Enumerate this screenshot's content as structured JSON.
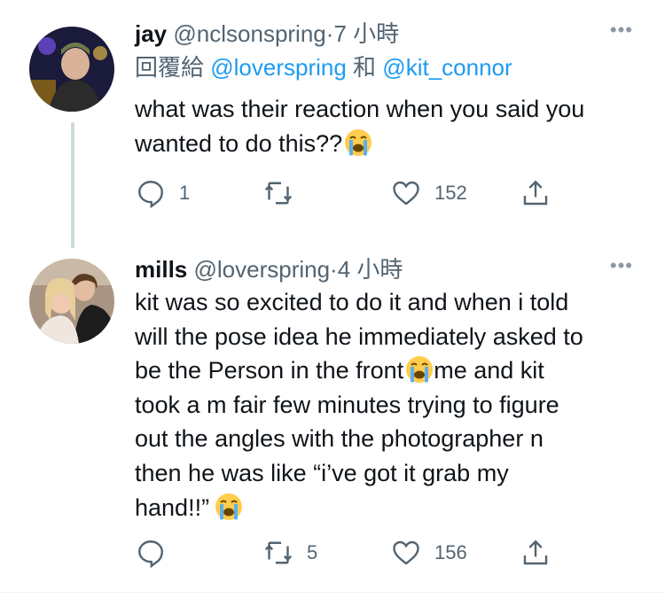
{
  "tweets": [
    {
      "display_name": "jay",
      "handle": "@nclsonspring",
      "separator": "·",
      "time": "7 小時",
      "reply_prefix": "回覆給",
      "reply_user1": "@loverspring",
      "reply_and": "和",
      "reply_user2": "@kit_connor",
      "text": "what was their reaction when you said you\nwanted to do this??",
      "reply_count": "1",
      "retweet_count": "",
      "like_count": "152"
    },
    {
      "display_name": "mills",
      "handle": "@loverspring",
      "separator": "·",
      "time": "4 小時",
      "text_part1": "kit was so excited to do it and when i told\nwill the pose idea he immediately asked to\nbe the Person in the front",
      "text_part2": "me and kit\ntook a m fair few minutes trying to figure\nout the angles with the photographer n\nthen he was like “i’ve got it grab my\nhand!!”",
      "reply_count": "",
      "retweet_count": "5",
      "like_count": "156"
    }
  ],
  "icons": {
    "more": "more-horizontal-icon",
    "reply": "reply-icon",
    "retweet": "retweet-icon",
    "like": "heart-icon",
    "share": "share-icon",
    "emoji": "loudly-crying-face-emoji"
  },
  "colors": {
    "text": "#0f1419",
    "secondary": "#536471",
    "link": "#1d9bf0",
    "thread_line": "#cfd9de"
  }
}
